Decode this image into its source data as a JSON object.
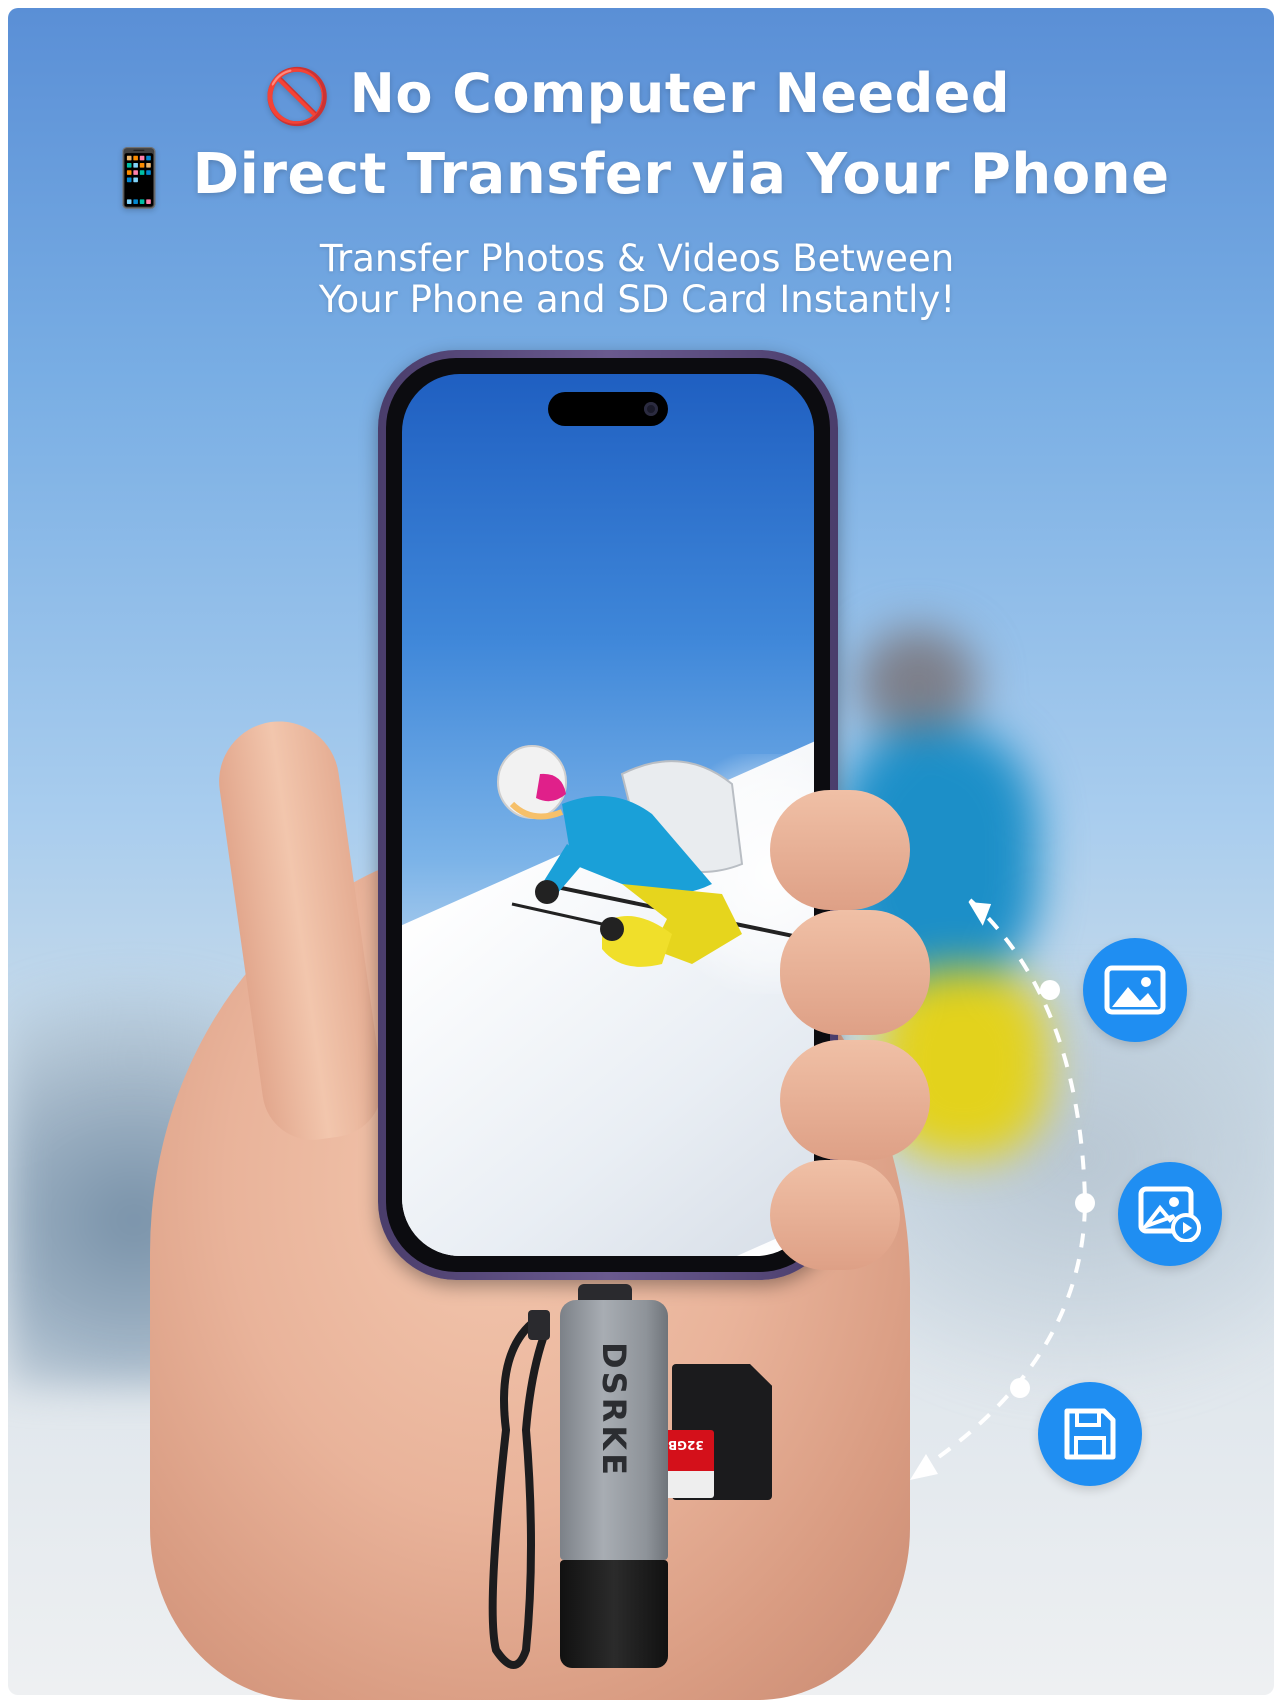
{
  "headline": {
    "line1_emoji": "🚫",
    "line1_text": "No Computer Needed",
    "line2_emoji": "📱",
    "line2_text": "Direct Transfer via Your Phone"
  },
  "subheadline": {
    "line1": "Transfer Photos & Videos Between",
    "line2": "Your Phone and SD Card Instantly!"
  },
  "product": {
    "brand": "DSRKE",
    "microsd_label": "32GB"
  },
  "icons": [
    "photo-icon",
    "photo-video-icon",
    "save-icon"
  ],
  "colors": {
    "icon_blue": "#1f8ef2",
    "sky_top": "#5a8fd6",
    "text": "#ffffff"
  }
}
